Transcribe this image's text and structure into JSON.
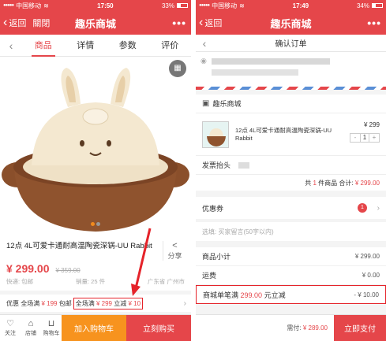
{
  "left": {
    "status": {
      "carrier": "中国移动",
      "time": "17:50",
      "battery": "33%",
      "battery_level": 0.33
    },
    "nav": {
      "back_label": "返回",
      "close_label": "關閉",
      "title": "趣乐商城",
      "more": "•••"
    },
    "tabs": [
      "商品",
      "详情",
      "参数",
      "评价"
    ],
    "active_tab": 0,
    "product": {
      "title": "12点 4L可爱卡通耐高温陶瓷深锅-UU Rabbit",
      "share_label": "分享",
      "price": "¥ 299.00",
      "old_price": "¥ 359.00",
      "shipping": "快递: 包邮",
      "sales": "销量: 25 件",
      "location": "广东省 广州市"
    },
    "promo": {
      "label": "优惠",
      "pre_a": "全场满",
      "pre_price": "¥ 199",
      "pre_b": "包邮",
      "hl_a": "全场满",
      "hl_price": "¥ 299",
      "hl_b": "立减",
      "hl_disc": "¥ 10"
    },
    "bottom": {
      "follow": "关注",
      "store": "店铺",
      "cart": "购物车",
      "add_to_cart": "加入购物车",
      "buy_now": "立刻购买"
    }
  },
  "right": {
    "status": {
      "carrier": "中国移动",
      "time": "17:49",
      "battery": "34%",
      "battery_level": 0.34
    },
    "nav": {
      "back_label": "返回",
      "title": "趣乐商城",
      "more": "•••"
    },
    "header_title": "确认订单",
    "shop_name": "趣乐商城",
    "item": {
      "name": "12点 4L可爱卡通耐高温陶瓷深锅-UU Rabbit",
      "price": "¥ 299",
      "qty": "1",
      "minus": "-",
      "plus": "+"
    },
    "invoice_label": "发票抬头",
    "total": {
      "pre": "共",
      "count": "1",
      "mid": "件商品 合计:",
      "amount": "¥ 299.00"
    },
    "coupon": {
      "label": "优惠券",
      "badge": "1"
    },
    "message_placeholder": "选填: 买家留言(50字以内)",
    "summary": [
      {
        "label": "商品小计",
        "value": "¥ 299.00"
      },
      {
        "label": "运费",
        "value": "¥ 0.00"
      }
    ],
    "discount": {
      "pre": "商城单笔满",
      "amount": "299.00",
      "post": "元立减",
      "value": "- ¥ 10.00"
    },
    "bottom": {
      "pay_label": "需付:",
      "pay_amount": "¥ 289.00",
      "pay_button": "立即支付"
    }
  },
  "colors": {
    "brand_red": "#e5464a",
    "orange": "#f7931e",
    "annotation_red": "#e5232a"
  }
}
